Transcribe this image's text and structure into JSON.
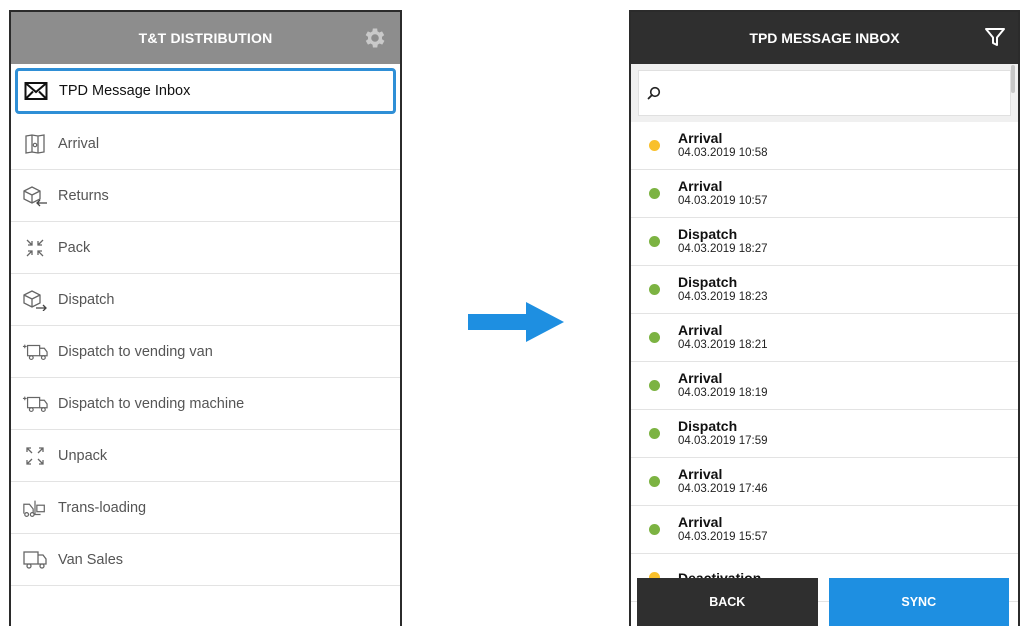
{
  "left_screen": {
    "title": "T&T DISTRIBUTION",
    "menu": [
      {
        "label": "TPD Message Inbox",
        "icon": "envelope-icon",
        "selected": true
      },
      {
        "label": "Arrival",
        "icon": "map-icon"
      },
      {
        "label": "Returns",
        "icon": "box-return-icon"
      },
      {
        "label": "Pack",
        "icon": "compress-arrows-icon"
      },
      {
        "label": "Dispatch",
        "icon": "box-dispatch-icon"
      },
      {
        "label": "Dispatch to vending van",
        "icon": "truck-icon"
      },
      {
        "label": "Dispatch to vending machine",
        "icon": "truck-icon"
      },
      {
        "label": "Unpack",
        "icon": "expand-arrows-icon"
      },
      {
        "label": "Trans-loading",
        "icon": "forklift-icon"
      },
      {
        "label": "Van Sales",
        "icon": "van-icon"
      }
    ]
  },
  "right_screen": {
    "title": "TPD MESSAGE INBOX",
    "search": {
      "placeholder": "",
      "value": ""
    },
    "messages": [
      {
        "type": "Arrival",
        "date": "04.03.2019 10:58",
        "status": "pending"
      },
      {
        "type": "Arrival",
        "date": "04.03.2019 10:57",
        "status": "ok"
      },
      {
        "type": "Dispatch",
        "date": "04.03.2019 18:27",
        "status": "ok"
      },
      {
        "type": "Dispatch",
        "date": "04.03.2019 18:23",
        "status": "ok"
      },
      {
        "type": "Arrival",
        "date": "04.03.2019 18:21",
        "status": "ok"
      },
      {
        "type": "Arrival",
        "date": "04.03.2019 18:19",
        "status": "ok"
      },
      {
        "type": "Dispatch",
        "date": "04.03.2019 17:59",
        "status": "ok"
      },
      {
        "type": "Arrival",
        "date": "04.03.2019 17:46",
        "status": "ok"
      },
      {
        "type": "Arrival",
        "date": "04.03.2019 15:57",
        "status": "ok"
      },
      {
        "type": "Deactivation",
        "date": "",
        "status": "pending"
      }
    ],
    "back_label": "BACK",
    "sync_label": "SYNC"
  },
  "colors": {
    "accent_blue": "#1e8fe1",
    "selected_border": "#2f8fd6",
    "status_ok": "#7cb342",
    "status_pending": "#f9c02b",
    "left_header": "#8d8d8d",
    "right_header": "#2f2f2f"
  }
}
